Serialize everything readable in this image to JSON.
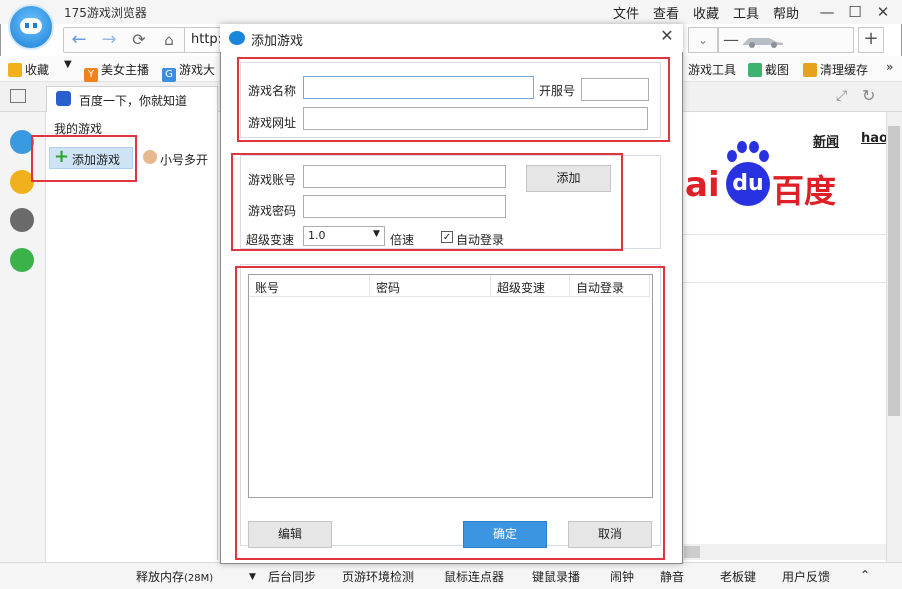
{
  "app": {
    "title": "175游戏浏览器",
    "menus": [
      "文件",
      "查看",
      "收藏",
      "工具",
      "帮助"
    ]
  },
  "address": {
    "url_prefix": "http:"
  },
  "bookmarks": {
    "left": [
      "收藏",
      "美女主播",
      "游戏大"
    ],
    "right": [
      "游戏工具",
      "截图",
      "清理缓存"
    ],
    "more": "»"
  },
  "tab": {
    "title": "百度一下，你就知道"
  },
  "games_panel": {
    "title": "我的游戏",
    "add_label": "添加游戏",
    "multi_label": "小号多开"
  },
  "baidu": {
    "links": [
      "新闻",
      "hao"
    ],
    "logo_left": "ai",
    "logo_du": "du",
    "logo_right": "百度"
  },
  "status": {
    "items": [
      "释放内存",
      "(28M)",
      "后台同步",
      "页游环境检测",
      "鼠标连点器",
      "键鼠录播",
      "闹钟",
      "静音",
      "老板键",
      "用户反馈"
    ]
  },
  "dialog": {
    "title": "添加游戏",
    "game_name_label": "游戏名称",
    "server_label": "开服号",
    "game_url_label": "游戏网址",
    "account_label": "游戏账号",
    "password_label": "游戏密码",
    "add_button": "添加",
    "speed_label": "超级变速",
    "speed_value": "1.0",
    "speed_unit": "倍速",
    "auto_login_label": "自动登录",
    "auto_login_checked": true,
    "table_headers": [
      "账号",
      "密码",
      "超级变速",
      "自动登录"
    ],
    "table_rows": [],
    "edit_button": "编辑",
    "ok_button": "确定",
    "cancel_button": "取消"
  },
  "colors": {
    "highlight_red": "#e0343f",
    "primary_blue": "#3c95e0",
    "selected_item": "#cfe3f7"
  }
}
